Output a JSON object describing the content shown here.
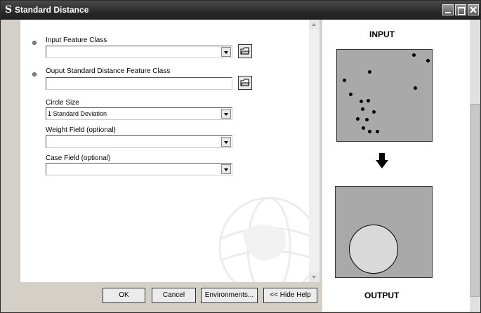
{
  "window": {
    "title": "Standard Distance",
    "app_icon": "arctoolbox-s-icon"
  },
  "form": {
    "input_feature_class": {
      "label": "Input Feature Class",
      "value": ""
    },
    "output_feature_class": {
      "label": "Ouput Standard Distance Feature Class",
      "value": ""
    },
    "circle_size": {
      "label": "Circle Size",
      "value": "1 Standard Deviation"
    },
    "weight_field": {
      "label": "Weight Field (optional)",
      "value": ""
    },
    "case_field": {
      "label": "Case Field (optional)",
      "value": ""
    }
  },
  "buttons": {
    "ok": "OK",
    "cancel": "Cancel",
    "environments": "Environments...",
    "hide_help": "<< Hide Help"
  },
  "help": {
    "input_heading": "INPUT",
    "output_heading": "OUTPUT"
  },
  "colors": {
    "diagram_fill": "#a9a9a9",
    "circle_fill": "#d9d9d9"
  }
}
